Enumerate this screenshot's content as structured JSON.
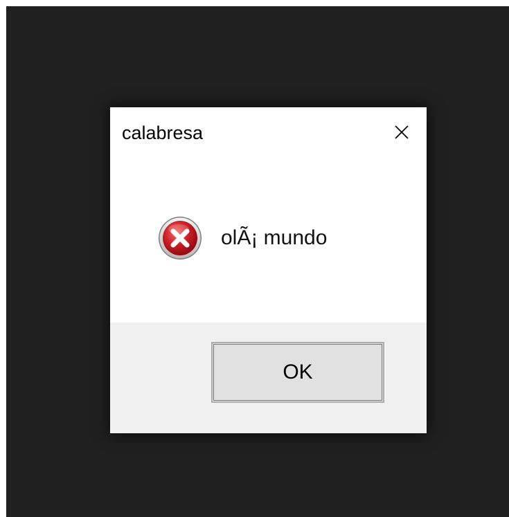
{
  "dialog": {
    "title": "calabresa",
    "close_icon": "close-icon",
    "message": "olÃ¡ mundo",
    "message_icon": "error-icon",
    "ok_label": "OK"
  },
  "colors": {
    "backdrop": "#202020",
    "dialog_bg": "#ffffff",
    "footer_bg": "#f0f0f0",
    "button_bg": "#e1e1e1",
    "error_red": "#c4161c"
  }
}
